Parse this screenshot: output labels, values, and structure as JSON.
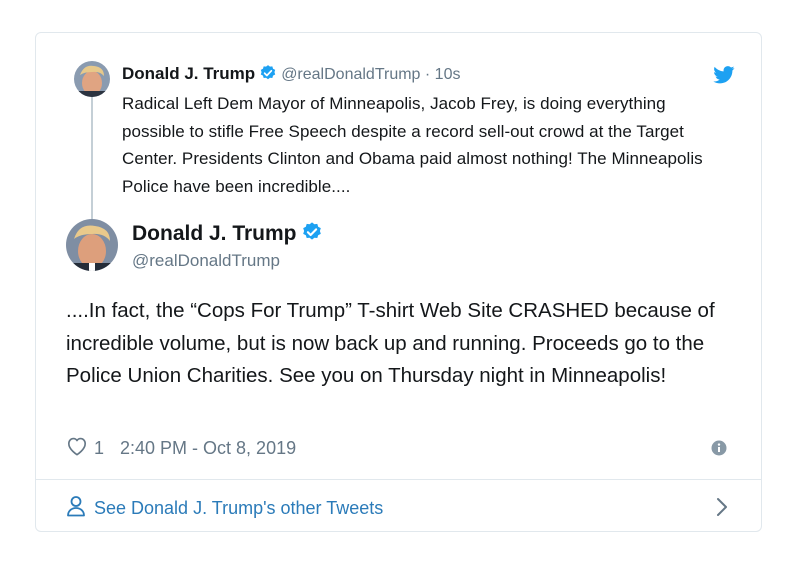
{
  "quoted_tweet": {
    "author_name": "Donald J. Trump",
    "handle_time": "@realDonaldTrump · 10s",
    "text": "Radical Left Dem Mayor of Minneapolis, Jacob Frey, is doing everything possible to stifle Free Speech despite a record sell-out crowd at the Target Center. Presidents Clinton and Obama paid almost nothing! The Minneapolis Police have been incredible...."
  },
  "main_tweet": {
    "author_name": "Donald J. Trump",
    "handle": "@realDonaldTrump",
    "text": "....In fact, the “Cops For Trump” T-shirt Web Site CRASHED because of incredible volume, but is now back up and running. Proceeds go to the Police Union Charities. See you on Thursday night in Minneapolis!",
    "like_count": "1",
    "timestamp": "2:40 PM - Oct 8, 2019"
  },
  "footer": {
    "link_label": "See Donald J. Trump's other Tweets"
  },
  "colors": {
    "link": "#2b7bb9",
    "verified": "#1da1f2",
    "muted": "#657786"
  },
  "icons": [
    "twitter-bird-icon",
    "verified-icon",
    "heart-icon",
    "info-icon",
    "person-icon",
    "chevron-right-icon"
  ]
}
